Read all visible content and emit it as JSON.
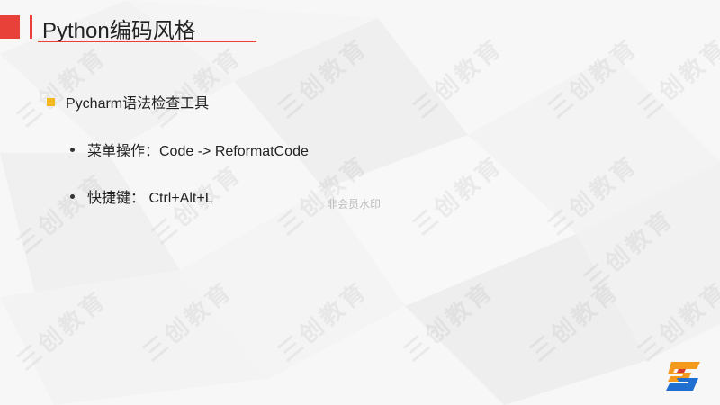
{
  "slide": {
    "title": "Python编码风格",
    "bullet_main": "Pycharm语法检查工具",
    "sub_bullets": [
      "菜单操作：Code -> ReformatCode",
      "快捷键： Ctrl+Alt+L"
    ]
  },
  "watermark_center": "非会员水印",
  "background_watermark_text": "三创教育",
  "colors": {
    "accent_red": "#e8413a",
    "bullet_yellow": "#f2b91c",
    "logo_orange": "#f39a1e",
    "logo_blue": "#1f6fd1"
  },
  "icons": {
    "logo": "sanchuang-logo-icon"
  }
}
